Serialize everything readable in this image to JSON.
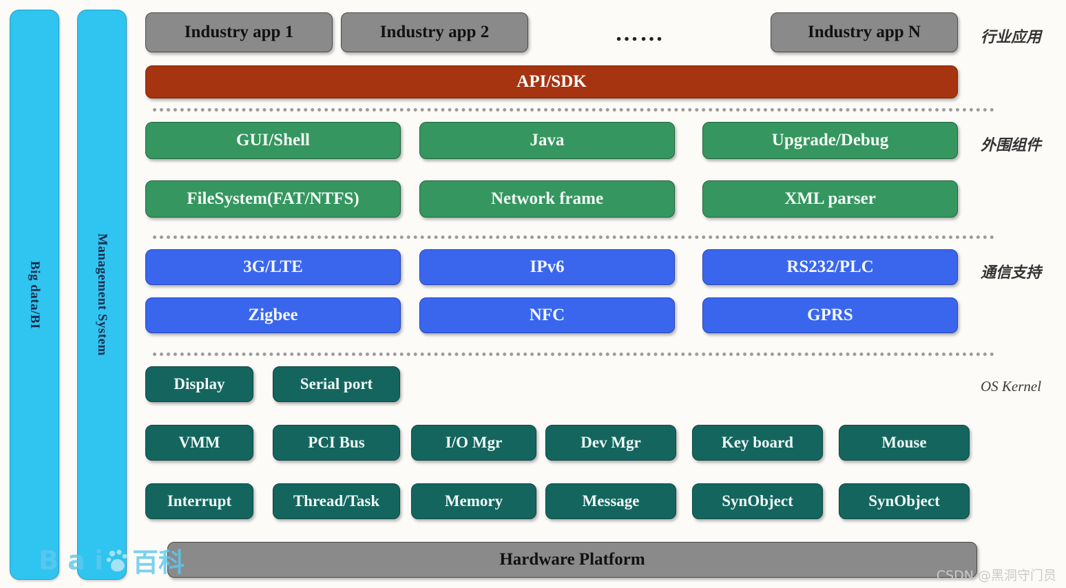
{
  "pillars": [
    {
      "id": "big-data-bi",
      "label": "Big data/BI"
    },
    {
      "id": "management-system",
      "label": "Management System"
    }
  ],
  "application_layer": {
    "apps": [
      {
        "label": "Industry app 1"
      },
      {
        "label": "Industry app 2"
      },
      {
        "label": "Industry app N"
      }
    ],
    "ellipsis": "……"
  },
  "api_layer": {
    "label": "API/SDK"
  },
  "peripheral_layer": {
    "row1": [
      {
        "label": "GUI/Shell"
      },
      {
        "label": "Java"
      },
      {
        "label": "Upgrade/Debug"
      }
    ],
    "row2": [
      {
        "label": "FileSystem(FAT/NTFS)"
      },
      {
        "label": "Network frame"
      },
      {
        "label": "XML parser"
      }
    ]
  },
  "communication_layer": {
    "row1": [
      {
        "label": "3G/LTE"
      },
      {
        "label": "IPv6"
      },
      {
        "label": "RS232/PLC"
      }
    ],
    "row2": [
      {
        "label": "Zigbee"
      },
      {
        "label": "NFC"
      },
      {
        "label": "GPRS"
      }
    ]
  },
  "kernel_layer": {
    "row1": [
      {
        "label": "Display"
      },
      {
        "label": "Serial port"
      }
    ],
    "row2": [
      {
        "label": "VMM"
      },
      {
        "label": "PCI Bus"
      },
      {
        "label": "I/O Mgr"
      },
      {
        "label": "Dev Mgr"
      },
      {
        "label": "Key board"
      },
      {
        "label": "Mouse"
      }
    ],
    "row3": [
      {
        "label": "Interrupt"
      },
      {
        "label": "Thread/Task"
      },
      {
        "label": "Memory"
      },
      {
        "label": "Message"
      },
      {
        "label": "SynObject"
      },
      {
        "label": "SynObject"
      }
    ]
  },
  "hardware_layer": {
    "label": "Hardware Platform"
  },
  "layer_captions": [
    {
      "id": "industry-application",
      "label": "行业应用"
    },
    {
      "id": "peripheral-components",
      "label": "外围组件"
    },
    {
      "id": "communication-support",
      "label": "通信支持"
    },
    {
      "id": "os-kernel",
      "label": "OS Kernel"
    }
  ],
  "watermarks": {
    "baidu_left": "B a i",
    "baidu_right": "百科",
    "csdn": "CSDN @黑洞守门员"
  },
  "colors": {
    "pillar": "#30c4f0",
    "app_gray": "#8a8a8a",
    "api_red": "#a63410",
    "peripheral_green": "#35965f",
    "communication_blue": "#3a66ee",
    "kernel_teal": "#15655f",
    "hardware_gray": "#8a8a8a",
    "separator": "#9c9c9c"
  }
}
